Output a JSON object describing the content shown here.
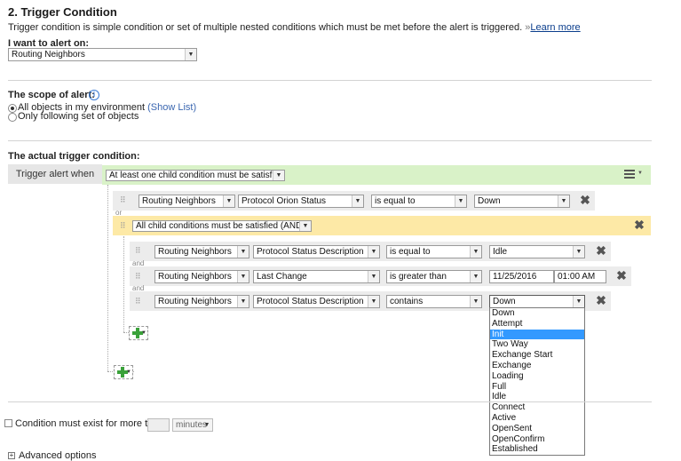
{
  "header": {
    "title": "2. Trigger Condition",
    "description": "Trigger condition is simple condition or set of multiple nested conditions which must be met before the alert is triggered.",
    "learn_more_marker": "»",
    "learn_more": "Learn more"
  },
  "alert_on": {
    "label": "I want to alert on:",
    "value": "Routing Neighbors"
  },
  "scope": {
    "label": "The scope of alert:",
    "info_icon": "info-icon",
    "options": [
      {
        "label": "All objects in my environment",
        "link": "(Show List)",
        "selected": true
      },
      {
        "label": "Only following set of objects",
        "selected": false
      }
    ]
  },
  "trigger": {
    "label": "The actual trigger condition:",
    "trigger_when": "Trigger alert when",
    "root_operator": "At least one child condition must be satisfied (OR)",
    "connector_or": "or",
    "connector_and": "and",
    "row1": {
      "object": "Routing Neighbors",
      "field": "Protocol Orion Status",
      "op": "is equal to",
      "value": "Down"
    },
    "group_operator": "All child conditions must be satisfied (AND)",
    "row2": {
      "object": "Routing Neighbors",
      "field": "Protocol Status Description",
      "op": "is equal to",
      "value": "Idle"
    },
    "row3": {
      "object": "Routing Neighbors",
      "field": "Last Change",
      "op": "is greater than",
      "date": "11/25/2016",
      "time": "01:00 AM"
    },
    "row4": {
      "object": "Routing Neighbors",
      "field": "Protocol Status Description",
      "op": "contains",
      "value": "Down"
    }
  },
  "dropdown": {
    "items": [
      "Down",
      "Attempt",
      "Init",
      "Two Way",
      "Exchange Start",
      "Exchange",
      "Loading",
      "Full",
      "Idle",
      "Connect",
      "Active",
      "OpenSent",
      "OpenConfirm",
      "Established"
    ],
    "highlighted_index": 2
  },
  "condition_exist": {
    "label": "Condition must exist for more than",
    "value": "",
    "unit": "minutes"
  },
  "advanced": {
    "label": "Advanced options",
    "icon": "expand-plus-icon"
  }
}
